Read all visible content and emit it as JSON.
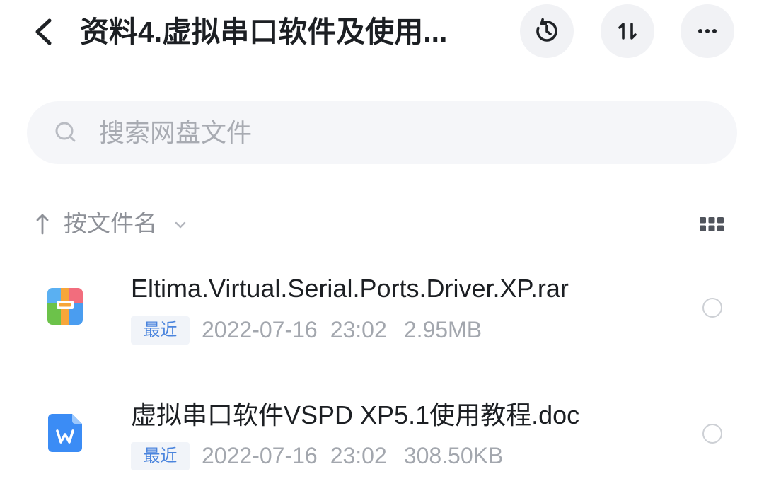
{
  "header": {
    "title": "资料4.虚拟串口软件及使用...",
    "back_icon": "chevron-left-icon",
    "action_icons": [
      "history-icon",
      "sort-arrows-icon",
      "more-horizontal-icon"
    ]
  },
  "search": {
    "placeholder": "搜索网盘文件",
    "icon": "search-icon"
  },
  "sort_bar": {
    "direction_icon": "arrow-up-icon",
    "label": "按文件名",
    "dropdown_icon": "chevron-down-icon",
    "view_toggle_icon": "grid-view-icon"
  },
  "files": [
    {
      "name": "Eltima.Virtual.Serial.Ports.Driver.XP.rar",
      "type_icon": "rar-archive-icon",
      "badge": "最近",
      "date": "2022-07-16",
      "time": "23:02",
      "size": "2.95MB",
      "selected": false
    },
    {
      "name": "虚拟串口软件VSPD XP5.1使用教程.doc",
      "type_icon": "word-document-icon",
      "badge": "最近",
      "date": "2022-07-16",
      "time": "23:02",
      "size": "308.50KB",
      "selected": false
    }
  ],
  "colors": {
    "background": "#ffffff",
    "text_primary": "#1c1f23",
    "text_secondary": "#a3a7ae",
    "sort_label": "#8e9198",
    "placeholder": "#a8abb2",
    "button_bg": "#f1f2f5",
    "search_bg": "#f5f6f9",
    "badge_bg": "#f1f4f9",
    "badge_text": "#4a84dd",
    "radio_border": "#cdd0d5",
    "icon_dark": "#1f2226"
  }
}
